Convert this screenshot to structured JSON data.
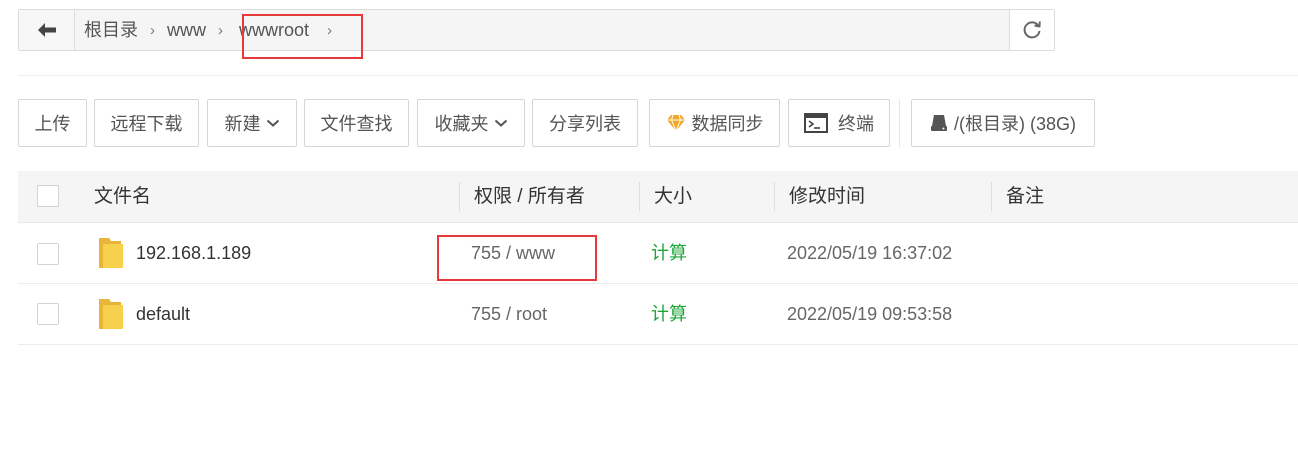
{
  "breadcrumb": {
    "items": [
      "根目录",
      "www",
      "wwwroot"
    ]
  },
  "toolbar": {
    "upload": "上传",
    "remote_download": "远程下载",
    "new": "新建",
    "file_search": "文件查找",
    "favorites": "收藏夹",
    "share_list": "分享列表",
    "sync": "数据同步",
    "terminal": "终端",
    "disk": "/(根目录) (38G)"
  },
  "table": {
    "headers": {
      "name": "文件名",
      "perm": "权限 / 所有者",
      "size": "大小",
      "mtime": "修改时间",
      "note": "备注"
    },
    "rows": [
      {
        "name": "192.168.1.189",
        "perm": "755 / www",
        "size": "计算",
        "mtime": "2022/05/19 16:37:02",
        "note": ""
      },
      {
        "name": "default",
        "perm": "755 / root",
        "size": "计算",
        "mtime": "2022/05/19 09:53:58",
        "note": ""
      }
    ]
  },
  "colors": {
    "accent_green": "#20a53a",
    "highlight_red": "#e8393a",
    "folder_yellow": "#f5c544"
  }
}
